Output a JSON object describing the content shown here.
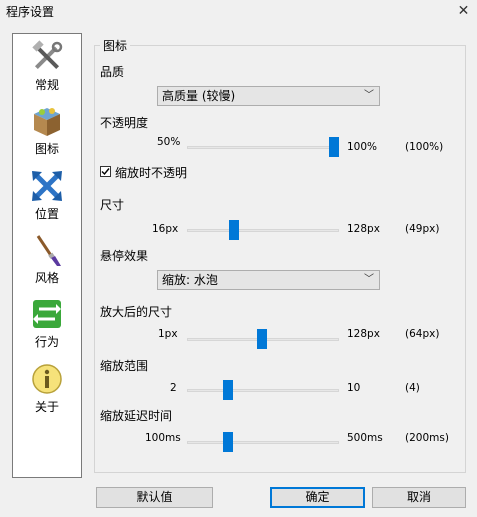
{
  "window": {
    "title": "程序设置",
    "close_glyph": "✕"
  },
  "sidebar": {
    "items": [
      {
        "label": "常规",
        "icon": "tools-icon"
      },
      {
        "label": "图标",
        "icon": "box-icon"
      },
      {
        "label": "位置",
        "icon": "move-arrows-icon"
      },
      {
        "label": "风格",
        "icon": "brush-icon"
      },
      {
        "label": "行为",
        "icon": "exchange-arrows-icon"
      },
      {
        "label": "关于",
        "icon": "info-icon"
      }
    ]
  },
  "group": {
    "legend": "图标"
  },
  "quality": {
    "label": "品质",
    "value": "高质量 (较慢)"
  },
  "opacity": {
    "label": "不透明度",
    "min": "50%",
    "max": "100%",
    "current": "(100%)",
    "level": 1.0
  },
  "opaque_on_zoom": {
    "label": "缩放时不透明",
    "checked": true
  },
  "size": {
    "label": "尺寸",
    "min": "16px",
    "max": "128px",
    "current": "(49px)",
    "level": 0.295
  },
  "hover": {
    "label": "悬停效果",
    "value": "缩放: 水泡"
  },
  "zoom_size": {
    "label": "放大后的尺寸",
    "min": "1px",
    "max": "128px",
    "current": "(64px)",
    "level": 0.496
  },
  "zoom_range": {
    "label": "缩放范围",
    "min": "2",
    "max": "10",
    "current": "(4)",
    "level": 0.25
  },
  "zoom_delay": {
    "label": "缩放延迟时间",
    "min": "100ms",
    "max": "500ms",
    "current": "(200ms)",
    "level": 0.25
  },
  "buttons": {
    "default": "默认值",
    "ok": "确定",
    "cancel": "取消"
  },
  "colors": {
    "accent": "#0078d7"
  }
}
